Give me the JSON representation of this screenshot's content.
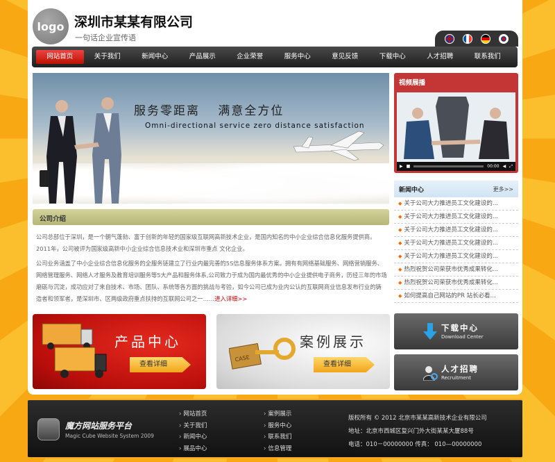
{
  "header": {
    "logo_text": "logo",
    "company_name": "深圳市某某有限公司",
    "slogan": "一句话企业宣传语",
    "languages": [
      "english-flag",
      "france-flag",
      "germany-flag",
      "korea-flag"
    ]
  },
  "nav": {
    "items": [
      {
        "label": "网站首页",
        "active": true
      },
      {
        "label": "关于我们"
      },
      {
        "label": "新闻中心"
      },
      {
        "label": "产品展示"
      },
      {
        "label": "企业荣誉"
      },
      {
        "label": "服务中心"
      },
      {
        "label": "意见反馈"
      },
      {
        "label": "下载中心"
      },
      {
        "label": "人才招聘"
      },
      {
        "label": "联系我们"
      }
    ]
  },
  "banner": {
    "title": "服务零距离　 满意全方位",
    "subtitle": "Omni-directional service zero distance satisfaction"
  },
  "intro": {
    "heading": "公司介绍",
    "paragraph1": "公司总部位于深圳，是一个朝气蓬勃、富于创新的年轻的国家级互联网高新技术企业，是国内知名的中小企业综合信息化服务提供商。2011年，公司被评为国家级高新中小企业综合信息技术业和深圳市重点 文化企业。",
    "paragraph2": "公司业务涵盖了中小企业综合信息化服务的全服务链建立了行业内最完善的5S信息服务体系方案。拥有有网络基础服务、网络营销服务、网络管理服务、网络人才服务及教育培训服务等5大产品和服务体系,公司致力于成为国内最优秀的中小企业提供电子商务，历经三年的市场磨砺与沉淀，成功应对了来自技术、市场、团队、系统等各方面的挑战与考验，如今公司已成为业内公认的互联网商业信息发布行业的铸造者和领军者，是深圳市、区两级政府重点扶持的互联网公司之一……",
    "more": "进入详细>>"
  },
  "promos": {
    "products": {
      "title": "产品中心",
      "button": "查看详细"
    },
    "cases": {
      "title": "案例展示",
      "button": "查看详细"
    }
  },
  "video": {
    "title": "视频展播",
    "time": "00:00"
  },
  "news": {
    "title": "新闻中心",
    "more": "更多>>",
    "items": [
      "关于公司大力推进员工文化建设的...",
      "关于公司大力推进员工文化建设的...",
      "关于公司大力推进员工文化建设的...",
      "关于公司大力推进员工文化建设的...",
      "关于公司大力推进员工文化建设的...",
      "热烈祝贺公司荣获市优秀成果转化...",
      "热烈祝贺公司荣获市优秀成果转化...",
      "如何提高自己网站的PR 站长必看..."
    ]
  },
  "side_buttons": {
    "download": {
      "title": "下载中心",
      "subtitle": "Download Center"
    },
    "recruit": {
      "title": "人才招聘",
      "subtitle": "Recruitment"
    }
  },
  "footer": {
    "brand": "魔方网站服务平台",
    "brand_en": "Magic Cube Website System 2009",
    "links_col1": [
      "网站首页",
      "关于我们",
      "新闻中心",
      "展品中心"
    ],
    "links_col2": [
      "案例展示",
      "服务中心",
      "联系我们",
      "信息管理"
    ],
    "copyright": "版权所有 © 2012 北京市某某高新技术企业有限公司",
    "address": "地址：北京市西城区复兴门外大街某某大厦88号",
    "phone": "电话：010－00000000  传真：  010—00000000"
  },
  "colors": {
    "nav_active": "#cc2222",
    "video_header": "#c43636",
    "accent_orange": "#f5a623"
  }
}
